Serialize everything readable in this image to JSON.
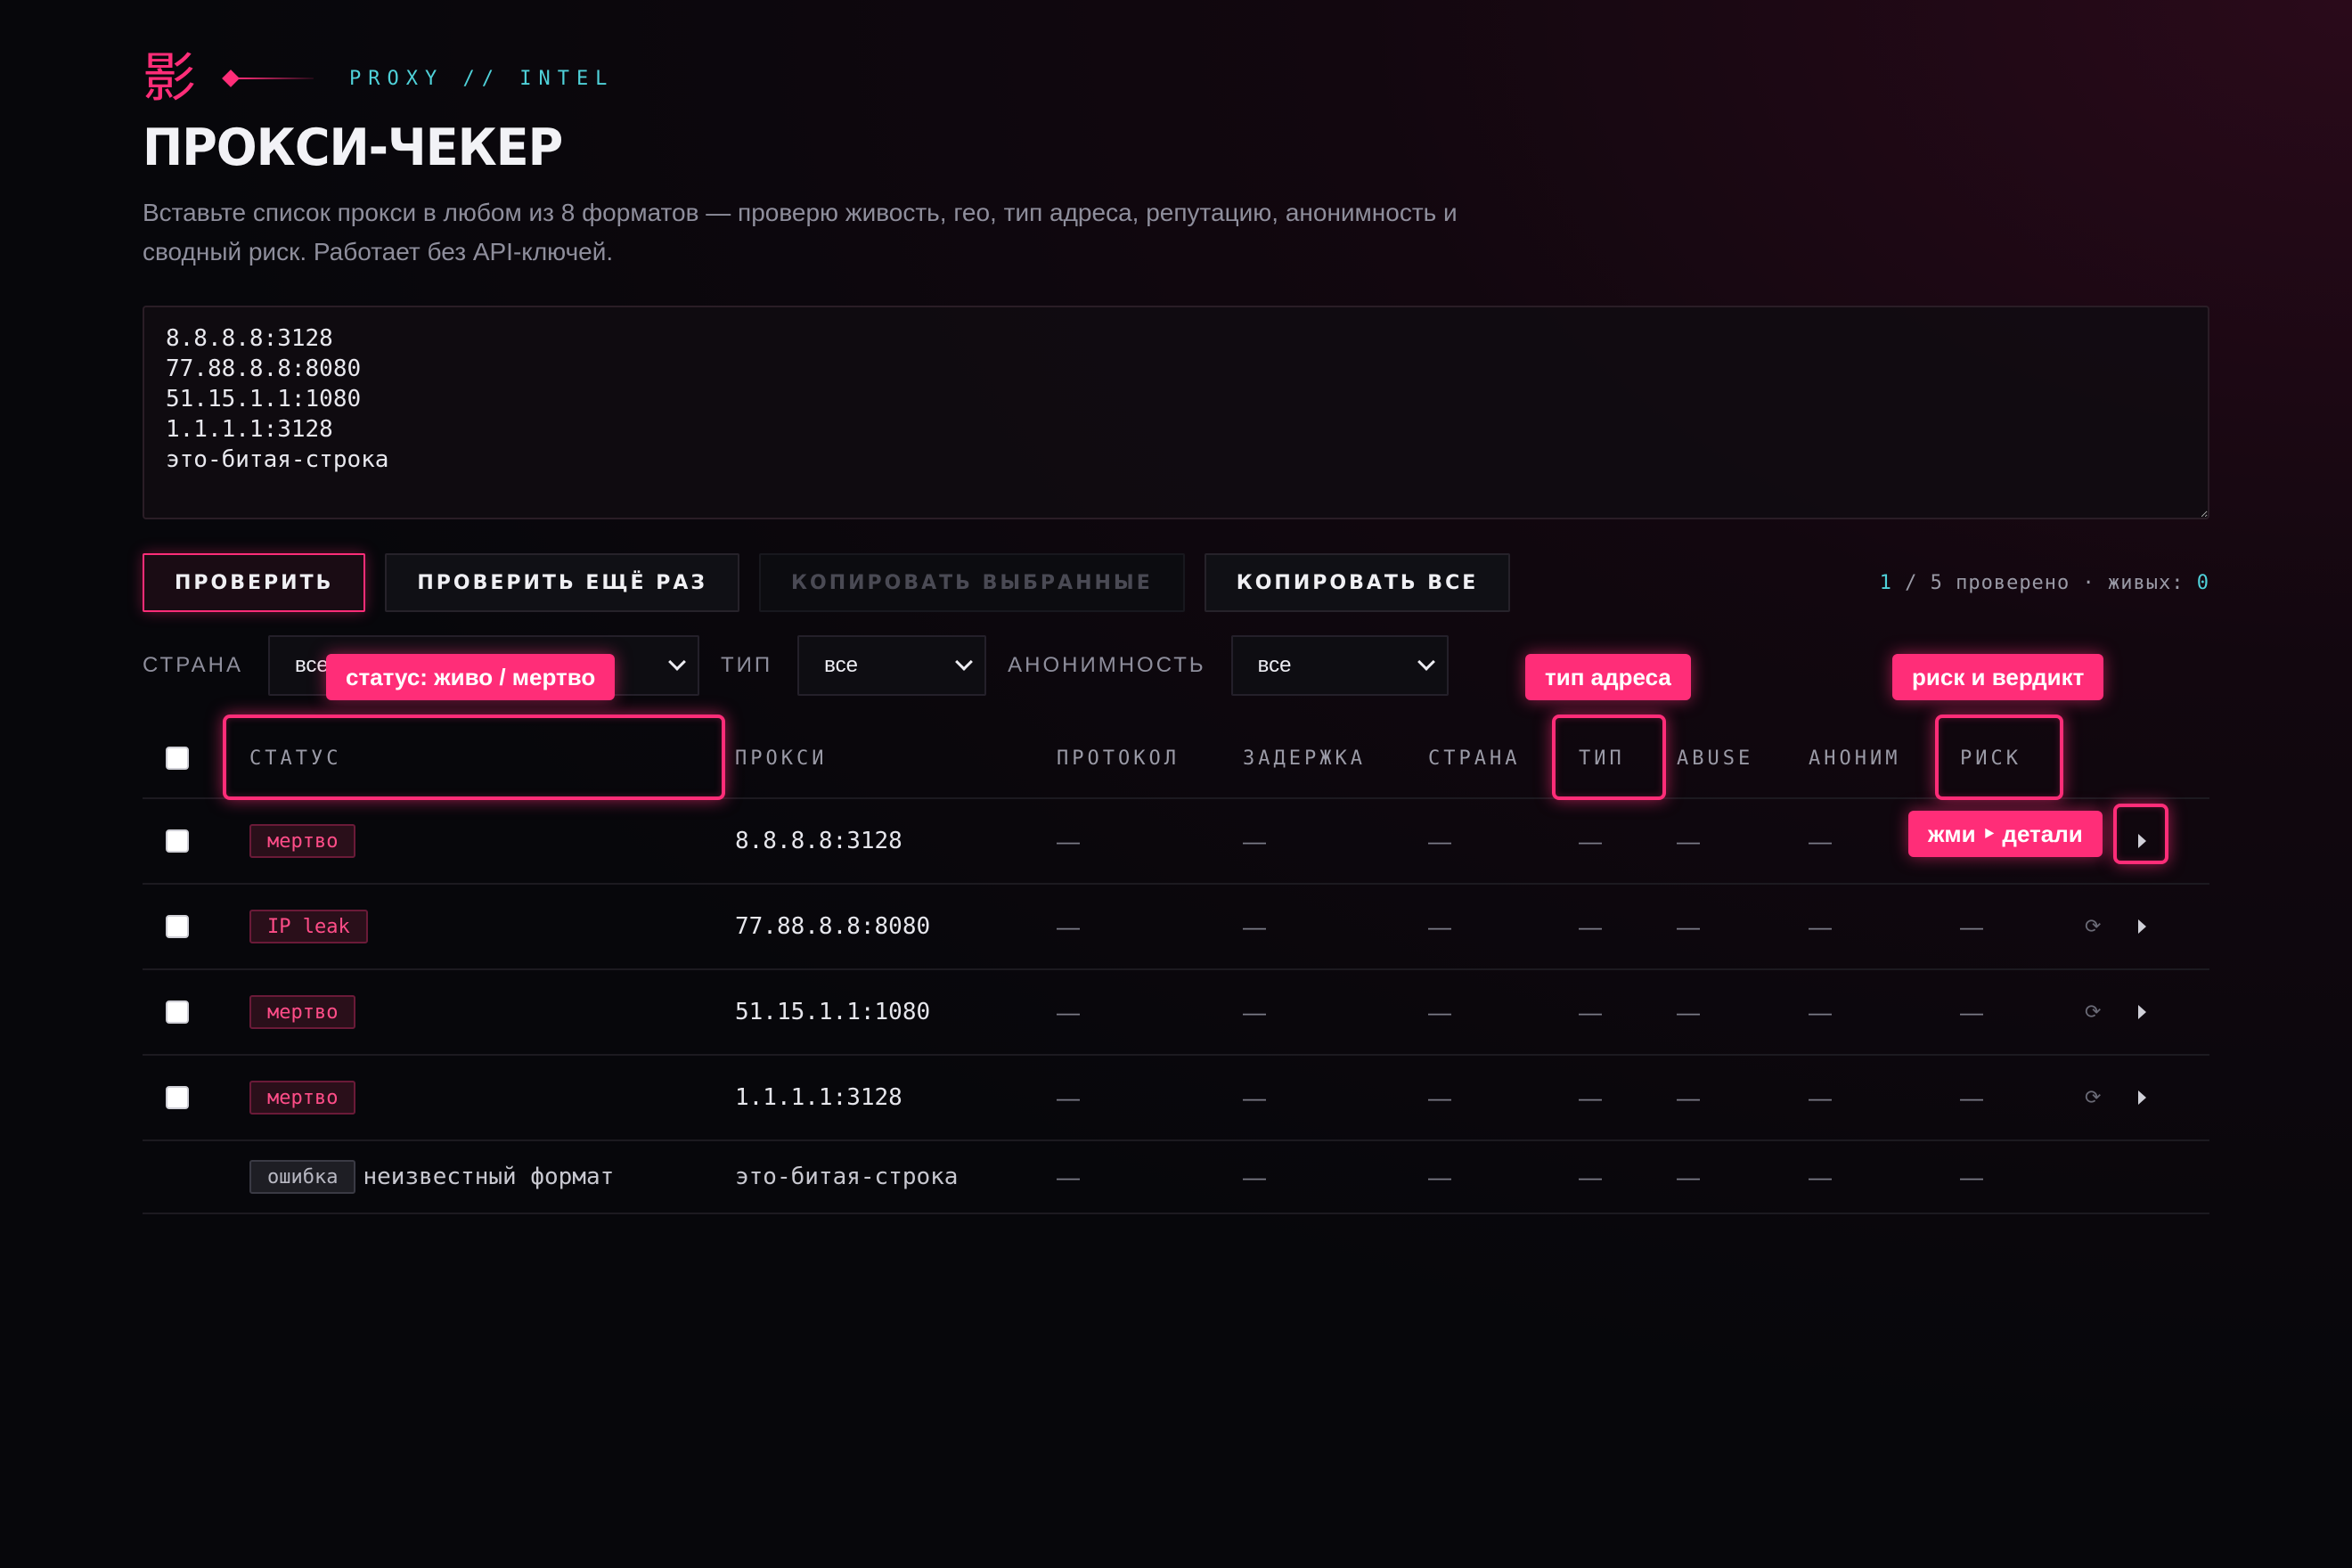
{
  "brand": {
    "kanji": "影",
    "tag": "PROXY // INTEL"
  },
  "title": "ПРОКСИ-ЧЕКЕР",
  "description": "Вставьте список прокси в любом из 8 форматов — проверю живость, гео, тип адреса, репутацию, анонимность и сводный риск. Работает без API-ключей.",
  "input": {
    "value": "8.8.8.8:3128\n77.88.8.8:8080\n51.15.1.1:1080\n1.1.1.1:3128\nэто-битая-строка"
  },
  "actions": {
    "check": "ПРОВЕРИТЬ",
    "recheck": "ПРОВЕРИТЬ ЕЩЁ РАЗ",
    "copy_selected": "КОПИРОВАТЬ ВЫБРАННЫЕ",
    "copy_all": "КОПИРОВАТЬ ВСЕ"
  },
  "counter": {
    "checked": "1",
    "sep": " / ",
    "total": "5",
    "checked_label": " проверено · живых: ",
    "alive": "0"
  },
  "filters": {
    "country_label": "СТРАНА",
    "country_value": "все",
    "type_label": "ТИП",
    "type_value": "все",
    "anon_label": "АНОНИМНОСТЬ",
    "anon_value": "все"
  },
  "callouts": {
    "status": "статус: живо / мертво",
    "addr_type": "тип адреса",
    "risk": "риск и вердикт",
    "details": "жми ‣ детали"
  },
  "table": {
    "headers": {
      "status": "СТАТУС",
      "proxy": "ПРОКСИ",
      "protocol": "ПРОТОКОЛ",
      "latency": "ЗАДЕРЖКА",
      "country": "СТРАНА",
      "type": "ТИП",
      "abuse": "ABUSE",
      "anon": "АНОНИМ",
      "risk": "РИСК"
    },
    "dash": "—",
    "refresh_icon": "⟳",
    "rows": [
      {
        "status": "мертво",
        "proxy": "8.8.8.8:3128"
      },
      {
        "status": "IP leak",
        "proxy": "77.88.8.8:8080"
      },
      {
        "status": "мертво",
        "proxy": "51.15.1.1:1080"
      },
      {
        "status": "мертво",
        "proxy": "1.1.1.1:3128"
      },
      {
        "status": "ошибка",
        "status_note": "неизвестный формат",
        "proxy": "это-битая-строка"
      }
    ]
  },
  "colors": {
    "accent": "#ff2d78",
    "cyan": "#4fd1d9",
    "bg": "#07070b"
  }
}
